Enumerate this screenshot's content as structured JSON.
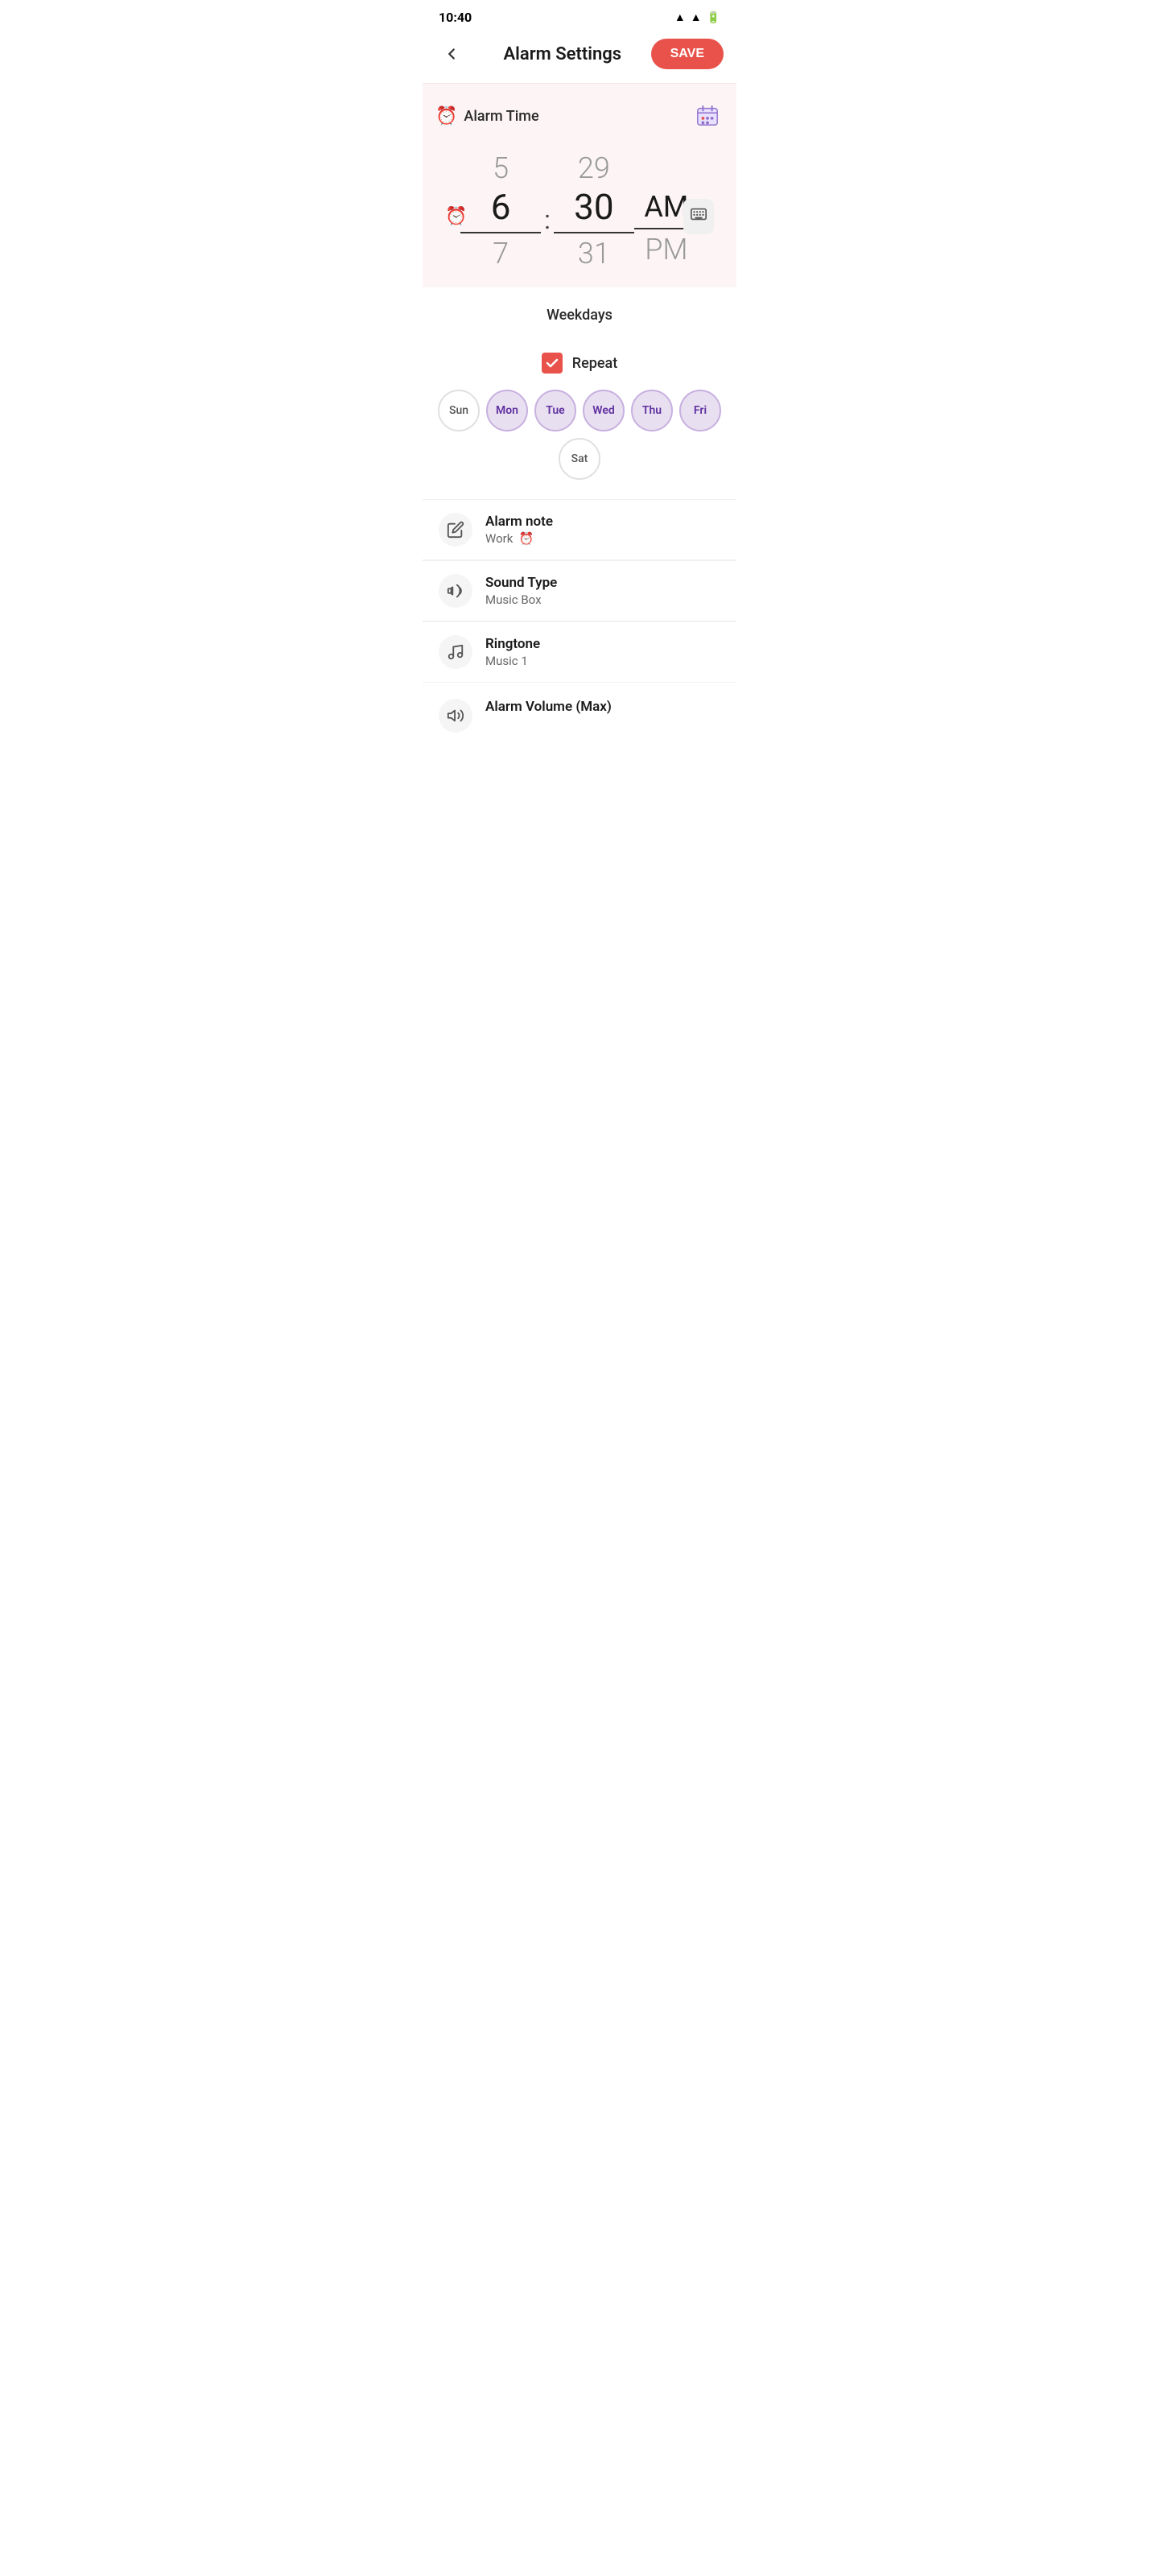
{
  "statusBar": {
    "time": "10:40",
    "icons": "📶📶🔋"
  },
  "header": {
    "backIcon": "←",
    "title": "Alarm Settings",
    "saveButton": "SAVE"
  },
  "alarmTime": {
    "sectionLabel": "Alarm Time",
    "clockEmoji": "⏰",
    "calendarEmoji": "📅",
    "hourAbove": "5",
    "hourSelected": "6",
    "hourBelow": "7",
    "minuteAbove": "29",
    "minuteSelected": "30",
    "minuteBelow": "31",
    "periodAbove": "",
    "periodSelected": "AM",
    "periodBelow": "PM",
    "separator": ":"
  },
  "weekdays": {
    "title": "Weekdays",
    "repeatLabel": "Repeat",
    "days": [
      {
        "label": "Sun",
        "active": false
      },
      {
        "label": "Mon",
        "active": true
      },
      {
        "label": "Tue",
        "active": true
      },
      {
        "label": "Wed",
        "active": true
      },
      {
        "label": "Thu",
        "active": true
      },
      {
        "label": "Fri",
        "active": true
      },
      {
        "label": "Sat",
        "active": false
      }
    ]
  },
  "settings": [
    {
      "id": "alarm-note",
      "icon": "✏️",
      "title": "Alarm note",
      "value": "Work  ⏰"
    },
    {
      "id": "sound-type",
      "icon": "🔔",
      "title": "Sound Type",
      "value": "Music Box"
    },
    {
      "id": "ringtone",
      "icon": "🎵",
      "title": "Ringtone",
      "value": "Music 1"
    },
    {
      "id": "alarm-volume",
      "icon": "🔊",
      "title": "Alarm Volume (Max)",
      "value": ""
    }
  ]
}
